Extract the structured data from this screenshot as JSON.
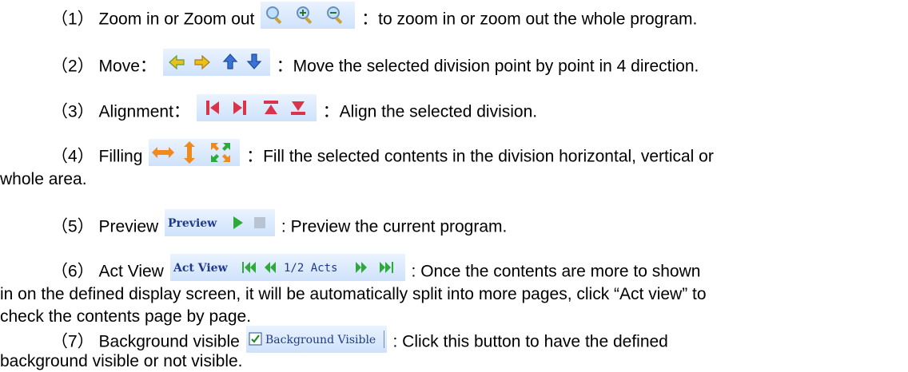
{
  "items": [
    {
      "num": "（1）",
      "label": "Zoom in or Zoom out",
      "text": "：to zoom in or zoom out the whole program.",
      "icons": [
        "zoom-fit-icon",
        "zoom-in-icon",
        "zoom-out-icon"
      ]
    },
    {
      "num": "（2）",
      "label": "Move：",
      "text": "：Move the selected division point by point in 4 direction.",
      "icons": [
        "arrow-left-icon",
        "arrow-right-icon",
        "arrow-up-icon",
        "arrow-down-icon"
      ]
    },
    {
      "num": "（3）",
      "label": "Alignment：",
      "text": "：Align the selected division.",
      "icons": [
        "align-left-icon",
        "align-right-icon",
        "align-top-icon",
        "align-bottom-icon"
      ]
    },
    {
      "num": "（4）",
      "label": "Filling",
      "text": "：Fill the selected contents in the division horizontal, vertical or",
      "continuation": "whole area.",
      "icons": [
        "fill-horizontal-icon",
        "fill-vertical-icon",
        "fill-whole-icon"
      ]
    },
    {
      "num": "（5）",
      "label": "Preview",
      "text": ": Preview the current program.",
      "toolbar_label": "Preview",
      "icons": [
        "play-icon",
        "stop-icon"
      ]
    },
    {
      "num": "（6）",
      "label": "Act View",
      "text": ": Once the contents are more to shown",
      "continuation": "in on the defined display screen, it will be automatically split into more pages, click “Act view” to",
      "continuation2": "check the contents page by page.",
      "toolbar_label": "Act View",
      "pager": "1/2 Acts",
      "icons": [
        "first-page-icon",
        "prev-page-icon",
        "next-page-icon",
        "last-page-icon"
      ]
    },
    {
      "num": "（7）",
      "label": "Background visible",
      "text": ": Click this button to have the defined",
      "continuation": "background visible or not visible.",
      "checkbox_label": "Background Visible",
      "checkbox_checked": true
    }
  ],
  "colors": {
    "toolbar_bg": "#d6e6fb",
    "icon_yellow": "#e8c21a",
    "icon_blue": "#3a72d6",
    "icon_red": "#d9344a",
    "icon_orange": "#f08a1c",
    "icon_green": "#2eaa3a"
  }
}
